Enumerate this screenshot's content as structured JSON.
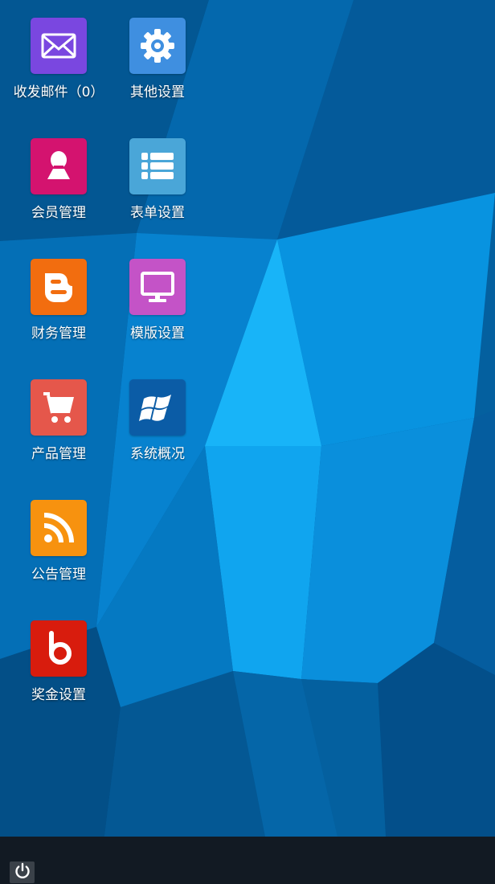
{
  "desktop": {
    "icons": [
      {
        "label": "收发邮件（0）",
        "icon": "mail-icon",
        "color": "#7a47e0"
      },
      {
        "label": "其他设置",
        "icon": "gear-icon",
        "color": "#3f8fe0"
      },
      {
        "label": "会员管理",
        "icon": "member-icon",
        "color": "#d4136f"
      },
      {
        "label": "表单设置",
        "icon": "list-icon",
        "color": "#4aa6d8"
      },
      {
        "label": "财务管理",
        "icon": "blogger-icon",
        "color": "#f26d0f"
      },
      {
        "label": "模版设置",
        "icon": "monitor-icon",
        "color": "#c453c7"
      },
      {
        "label": "产品管理",
        "icon": "cart-icon",
        "color": "#e5574b"
      },
      {
        "label": "系统概况",
        "icon": "windows-icon",
        "color": "#0b5ca6"
      },
      {
        "label": "公告管理",
        "icon": "rss-icon",
        "color": "#f7920f"
      },
      {
        "label": "奖金设置",
        "icon": "bing-icon",
        "color": "#d81c0d"
      }
    ]
  },
  "taskbar": {
    "power_icon": "power-icon",
    "background": "#121a23"
  }
}
